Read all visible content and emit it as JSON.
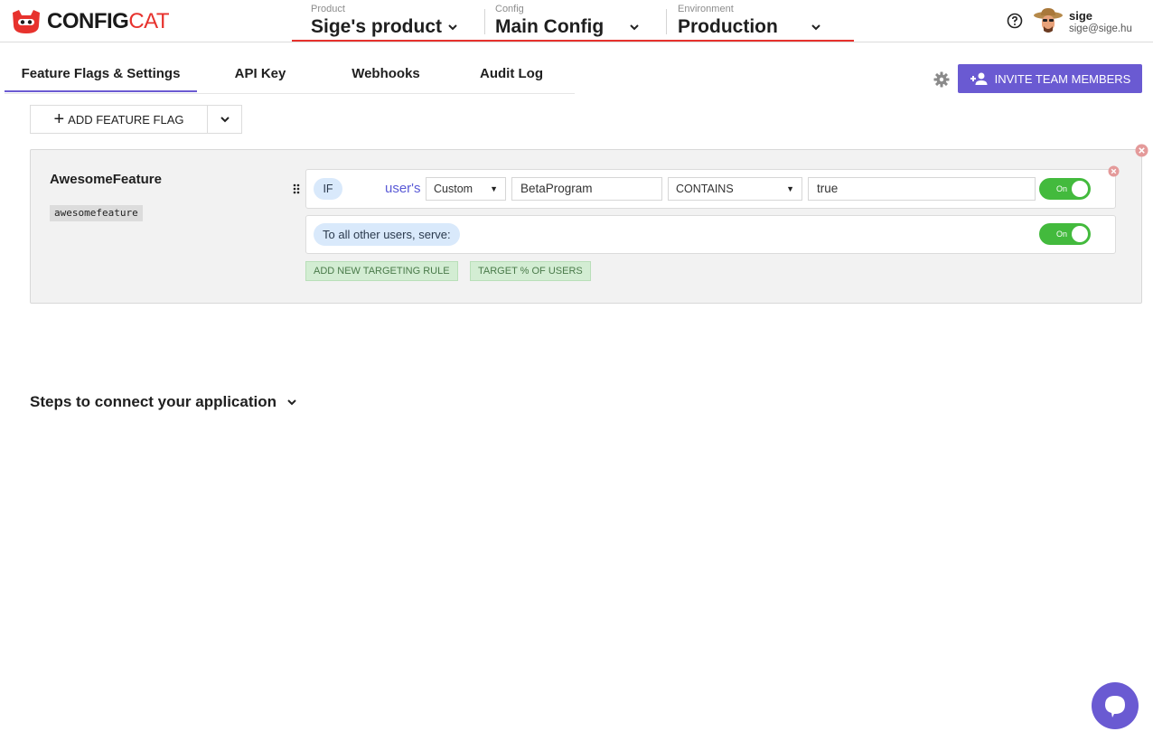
{
  "header": {
    "logo": {
      "strong": "CONFIG",
      "light": "CAT"
    },
    "product": {
      "label": "Product",
      "value": "Sige's product"
    },
    "config": {
      "label": "Config",
      "value": "Main Config"
    },
    "environment": {
      "label": "Environment",
      "value": "Production"
    },
    "user": {
      "name": "sige",
      "email": "sige@sige.hu"
    }
  },
  "tabs": [
    {
      "label": "Feature Flags & Settings",
      "active": true
    },
    {
      "label": "API Key",
      "active": false
    },
    {
      "label": "Webhooks",
      "active": false
    },
    {
      "label": "Audit Log",
      "active": false
    }
  ],
  "toolbar": {
    "invite_label": "INVITE TEAM MEMBERS",
    "add_flag_label": "ADD FEATURE FLAG"
  },
  "flag": {
    "name": "AwesomeFeature",
    "key": "awesomefeature",
    "rule": {
      "if_label": "IF",
      "users_text": "user's",
      "attribute": "Custom",
      "attribute_value": "BetaProgram",
      "comparator": "CONTAINS",
      "comparison_value": "true",
      "serve": "On"
    },
    "default": {
      "label": "To all other users, serve:",
      "serve": "On"
    },
    "add_rule_label": "ADD NEW TARGETING RULE",
    "target_percent_label": "TARGET % OF USERS"
  },
  "steps_label": "Steps to connect your application",
  "colors": {
    "accent": "#6a5ad2",
    "brand_red": "#e7322d",
    "toggle_on": "#43ba3d"
  }
}
